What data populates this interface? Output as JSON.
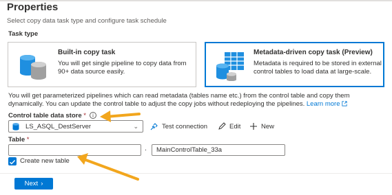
{
  "header": {
    "title": "Properties",
    "subtitle": "Select copy data task type and configure task schedule"
  },
  "task_type": {
    "label": "Task type",
    "builtin": {
      "title": "Built-in copy task",
      "description": "You will get single pipeline to copy data from 90+ data source easily."
    },
    "metadata": {
      "title": "Metadata-driven copy task (Preview)",
      "description": "Metadata is required to be stored in external control tables to load data at large-scale.",
      "selected": true
    }
  },
  "info": {
    "text": "You will get parameterized pipelines which can read metadata (tables name etc.) from the control table and copy them dynamically. You can update the control table to adjust the copy jobs without redeploying the pipelines.",
    "link": "Learn more"
  },
  "control_store": {
    "label": "Control table data store",
    "required": "*",
    "selected": "LS_ASQL_DestServer",
    "actions": {
      "test": "Test connection",
      "edit": "Edit",
      "new": "New"
    }
  },
  "table": {
    "label": "Table",
    "required": "*",
    "schema_value": "",
    "separator": ".",
    "name_value": "MainControlTable_33a",
    "create_new_label": "Create new table",
    "create_new_checked": true
  },
  "footer": {
    "next_label": "Next"
  },
  "colors": {
    "accent": "#0078d4",
    "annotation_arrow": "#f2a61d"
  },
  "icons": {
    "builtin": "database-stack-icon",
    "metadata": "metadata-table-icon",
    "info": "info-icon",
    "db": "sql-database-icon",
    "test": "plug-connection-icon",
    "edit": "pencil-icon",
    "new": "plus-icon",
    "next": "chevron-right-icon"
  }
}
